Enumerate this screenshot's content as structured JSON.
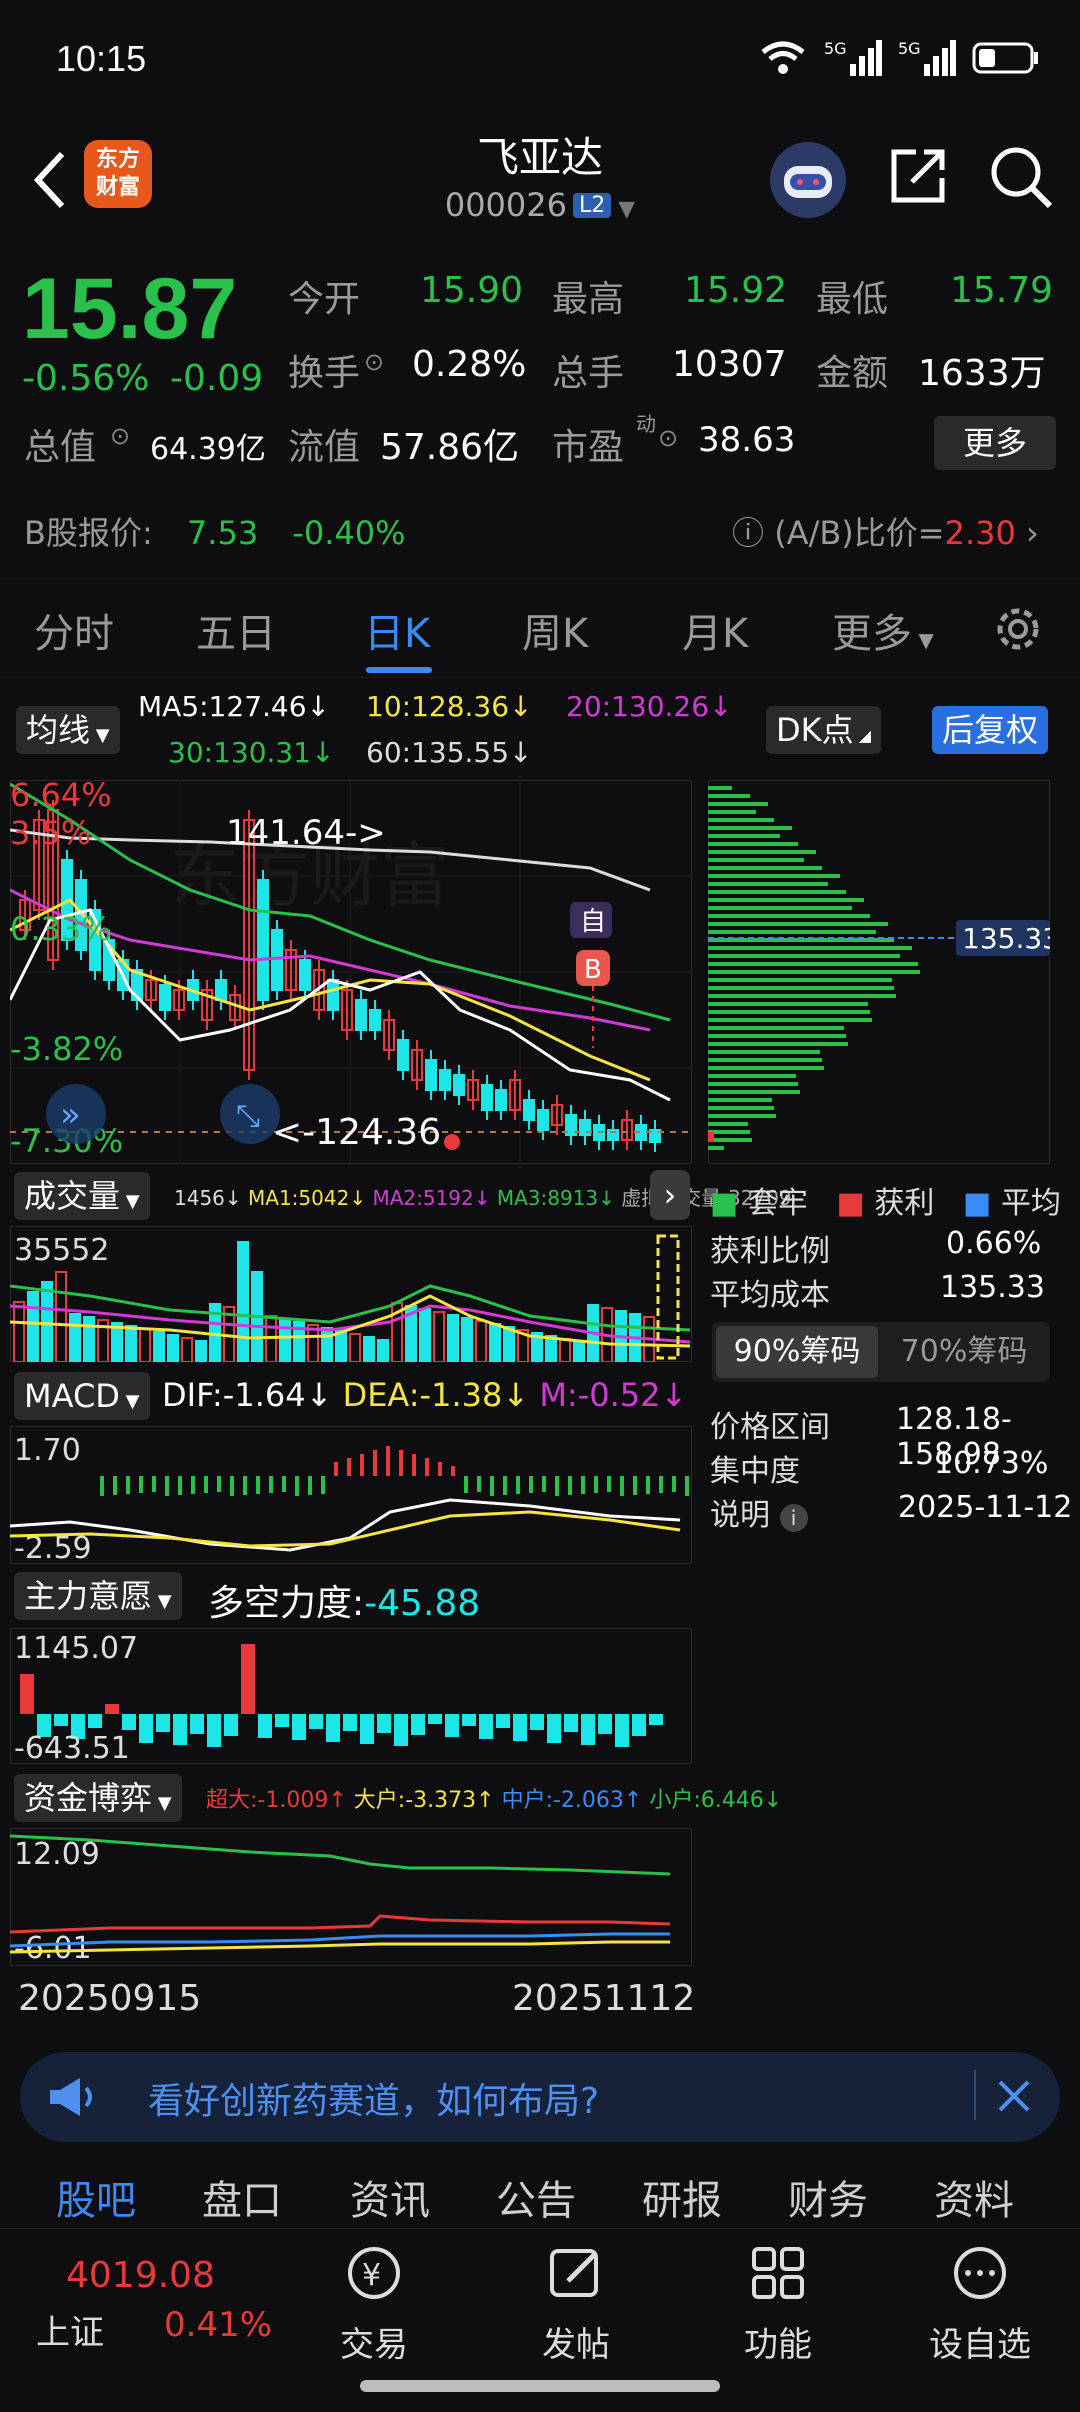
{
  "status": {
    "time": "10:15",
    "signal1": "5G",
    "signal2": "5G"
  },
  "header": {
    "logo": "东方\n财富",
    "title": "飞亚达",
    "code": "000026",
    "level": "L2"
  },
  "quote": {
    "price": "15.87",
    "change_pct": "-0.56%",
    "change_abs": "-0.09",
    "open_label": "今开",
    "open": "15.90",
    "high_label": "最高",
    "high": "15.92",
    "low_label": "最低",
    "low": "15.79",
    "turnover_label": "换手",
    "turnover": "0.28%",
    "volume_label": "总手",
    "volume": "10307",
    "amount_label": "金额",
    "amount": "1633万",
    "mktcap_label": "总值",
    "mktcap": "64.39亿",
    "float_label": "流值",
    "float": "57.86亿",
    "pe_label": "市盈",
    "pe_sup": "动",
    "pe": "38.63",
    "more": "更多",
    "bshare_label": "B股报价:",
    "bshare_price": "7.53",
    "bshare_pct": "-0.40%",
    "ab_ratio_label": "(A/B)比价=",
    "ab_ratio": "2.30"
  },
  "tabs": [
    "分时",
    "五日",
    "日K",
    "周K",
    "月K",
    "更多"
  ],
  "active_tab": "日K",
  "kline": {
    "ma_chip": "均线",
    "ma5": "MA5:127.46↓",
    "ma10": "10:128.36↓",
    "ma20": "20:130.26↓",
    "ma30": "30:130.31↓",
    "ma60": "60:135.55↓",
    "dk": "DK点",
    "restore": "后复权",
    "top_pct": "6.64%",
    "pct2": "3.5%",
    "pct3": "0.33%",
    "pct4": "-3.82%",
    "bottom_pct": "-7.30%",
    "high_mark": "141.64->",
    "low_mark": "<-124.36",
    "badge_self": "自",
    "badge_b": "B"
  },
  "volume": {
    "chip": "成交量",
    "info": "1456↓",
    "ma1": "MA1:5042↓",
    "ma2": "MA2:5192↓",
    "ma3": "MA3:8913↓",
    "virt": "虚拟成交量:32709",
    "max": "35552"
  },
  "macd": {
    "chip": "MACD",
    "dif": "DIF:-1.64↓",
    "dea": "DEA:-1.38↓",
    "m": "M:-0.52↓",
    "top": "1.70",
    "bottom": "-2.59"
  },
  "main_force": {
    "chip": "主力意愿",
    "label": "多空力度:",
    "value": "-45.88",
    "top": "1145.07",
    "bottom": "-643.51"
  },
  "fund": {
    "chip": "资金博弈",
    "super": "超大:-1.009↑",
    "large": "大户:-3.373↑",
    "mid": "中户:-2.063↑",
    "small": "小户:6.446↓",
    "top": "12.09",
    "bottom": "-6.01"
  },
  "dates": {
    "start": "20250915",
    "end": "20251112"
  },
  "chips": {
    "price_tag": "135.33",
    "legend_trap": "套牢",
    "legend_profit": "获利",
    "legend_avg": "平均",
    "profit_ratio_label": "获利比例",
    "profit_ratio": "0.66%",
    "avg_cost_label": "平均成本",
    "avg_cost": "135.33",
    "tab90": "90%筹码",
    "tab70": "70%筹码",
    "range_label": "价格区间",
    "range": "128.18-158.98",
    "conc_label": "集中度",
    "conc": "10.73%",
    "note_label": "说明",
    "note_date": "2025-11-12"
  },
  "news": {
    "text": "看好创新药赛道，如何布局?"
  },
  "bottom_tabs": [
    "股吧",
    "盘口",
    "资讯",
    "公告",
    "研报",
    "财务",
    "资料"
  ],
  "footer": {
    "index_value": "4019.08",
    "index_name": "上证",
    "index_pct": "0.41%",
    "trade": "交易",
    "post": "发帖",
    "func": "功能",
    "watch": "设自选"
  },
  "colors": {
    "up": "#e83a3a",
    "down": "#29c04c",
    "accent": "#3a8cf5",
    "cyan": "#1ee5e8"
  }
}
